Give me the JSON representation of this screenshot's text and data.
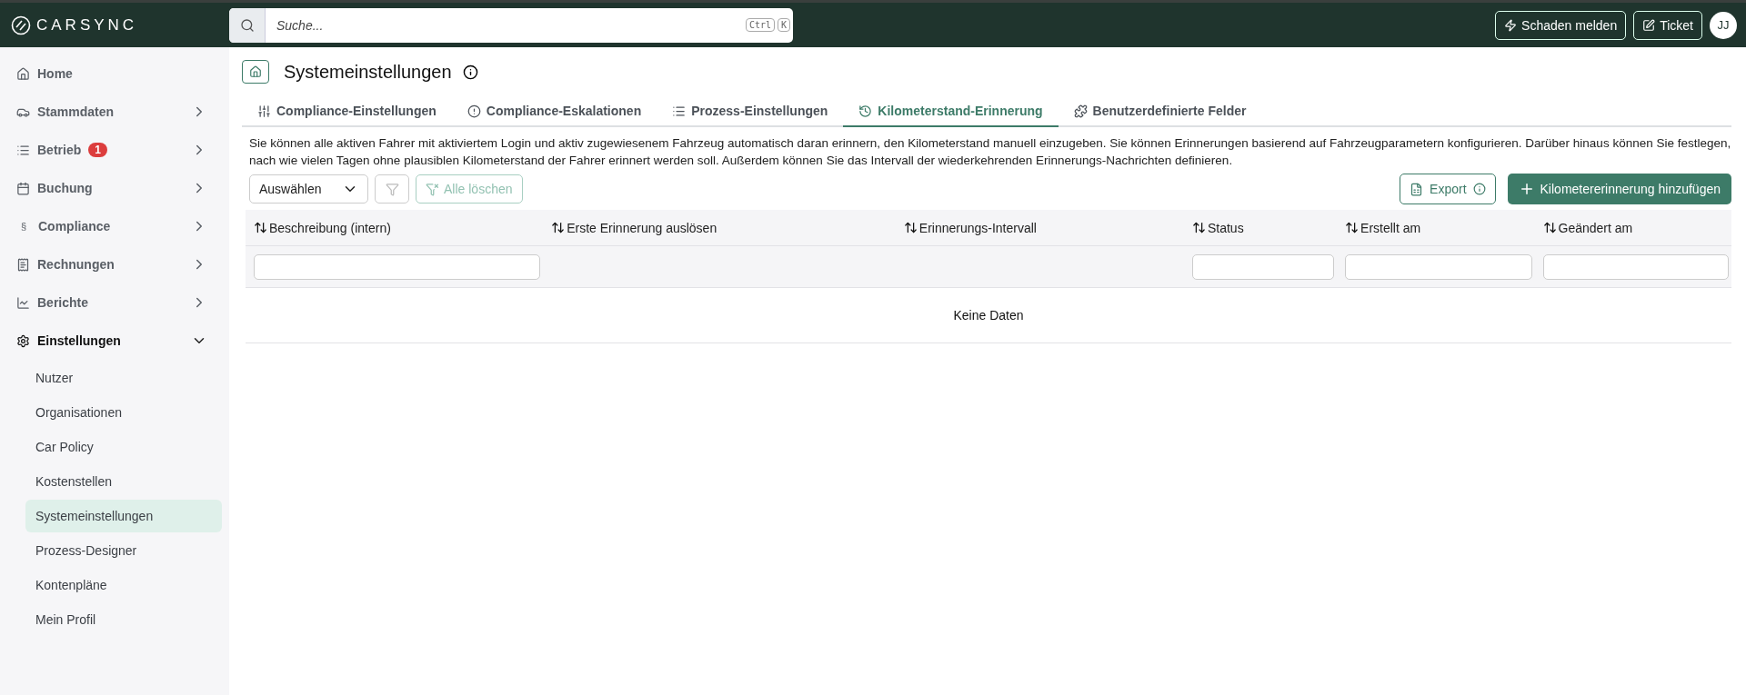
{
  "topbar": {
    "logo": "CARSYNC",
    "search": {
      "placeholder": "Suche...",
      "shortcut": [
        "Ctrl",
        "K"
      ]
    },
    "buttons": [
      {
        "label": "Schaden melden"
      },
      {
        "label": "Ticket"
      }
    ],
    "avatar": "JJ"
  },
  "sidebar": {
    "items": [
      {
        "label": "Home",
        "kind": "link"
      },
      {
        "label": "Stammdaten",
        "kind": "group",
        "expanded": false
      },
      {
        "label": "Betrieb",
        "kind": "group",
        "expanded": false,
        "badge": "1"
      },
      {
        "label": "Buchung",
        "kind": "group",
        "expanded": false
      },
      {
        "label": "Compliance",
        "icon_char": "§",
        "kind": "group",
        "expanded": false
      },
      {
        "label": "Rechnungen",
        "kind": "group",
        "expanded": false
      },
      {
        "label": "Berichte",
        "kind": "group",
        "expanded": false
      },
      {
        "label": "Einstellungen",
        "kind": "group",
        "expanded": true,
        "children": [
          {
            "label": "Nutzer",
            "selected": false
          },
          {
            "label": "Organisationen",
            "selected": false
          },
          {
            "label": "Car Policy",
            "selected": false
          },
          {
            "label": "Kostenstellen",
            "selected": false
          },
          {
            "label": "Systemeinstellungen",
            "selected": true
          },
          {
            "label": "Prozess-Designer",
            "selected": false
          },
          {
            "label": "Kontenpläne",
            "selected": false
          },
          {
            "label": "Mein Profil",
            "selected": false
          }
        ]
      }
    ]
  },
  "page": {
    "title": "Systemeinstellungen",
    "tabs": [
      {
        "label": "Compliance-Einstellungen",
        "selected": false
      },
      {
        "label": "Compliance-Eskalationen",
        "selected": false
      },
      {
        "label": "Prozess-Einstellungen",
        "selected": false
      },
      {
        "label": "Kilometerstand-Erinnerung",
        "selected": true
      },
      {
        "label": "Benutzerdefinierte Felder",
        "selected": false
      }
    ],
    "description": "Sie können alle aktiven Fahrer mit aktiviertem Login und aktiv zugewiesenem Fahrzeug automatisch daran erinnern, den Kilometerstand manuell einzugeben. Sie können Erinnerungen basierend auf Fahrzeugparametern konfigurieren. Darüber hinaus können Sie festlegen, nach wie vielen Tagen ohne plausiblen Kilometerstand der Fahrer erinnert werden soll. Außerdem können Sie das Intervall der wiederkehrenden Erinnerungs-Nachrichten definieren.",
    "select": "Auswählen",
    "filter_button": {
      "disabled": true
    },
    "clear_button": {
      "label": "Alle löschen",
      "disabled": true
    },
    "export_button": "Export",
    "add_button": "Kilometererinnerung hinzufügen",
    "table": {
      "columns": [
        {
          "label": "Beschreibung (intern)",
          "filter": true
        },
        {
          "label": "Erste Erinnerung auslösen",
          "filter": false
        },
        {
          "label": "Erinnerungs-Intervall",
          "filter": false
        },
        {
          "label": "Status",
          "filter": true
        },
        {
          "label": "Erstellt am",
          "filter": true
        },
        {
          "label": "Geändert am",
          "filter": true
        }
      ],
      "empty": "Keine Daten"
    }
  }
}
